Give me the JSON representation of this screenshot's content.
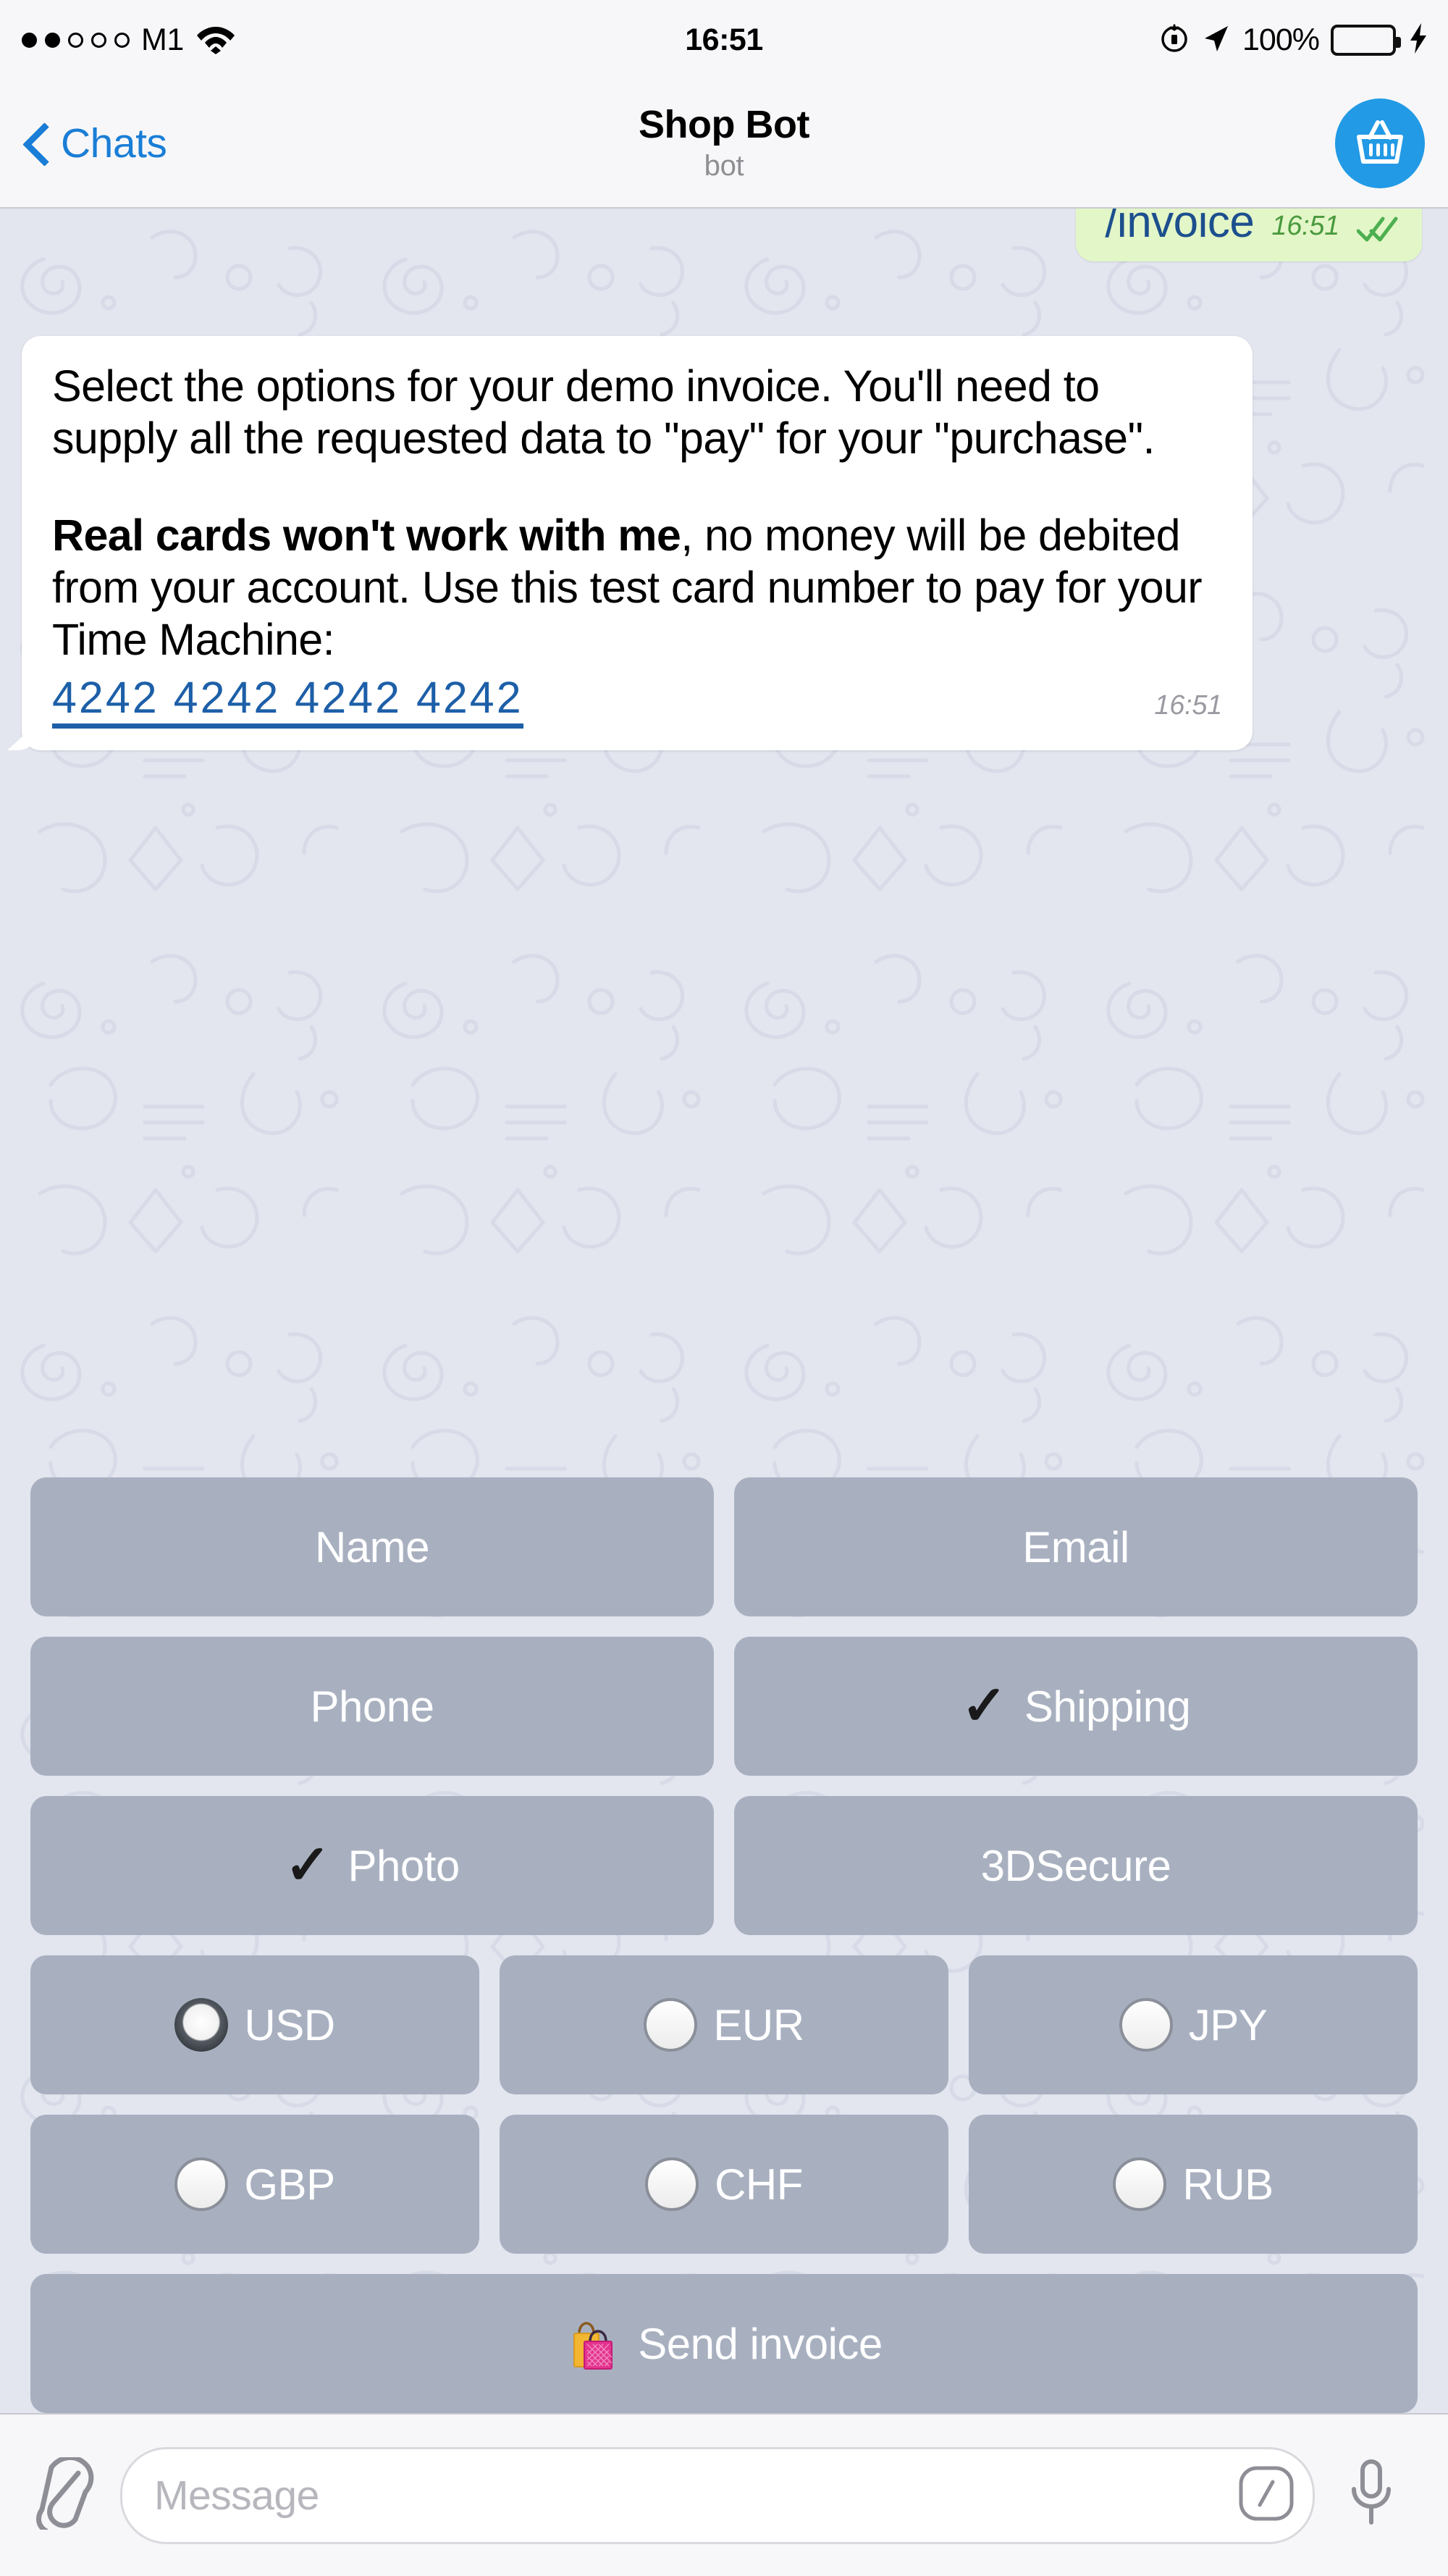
{
  "status_bar": {
    "carrier": "M1",
    "signal_dots_filled": 2,
    "signal_dots_total": 5,
    "wifi_icon": "wifi-icon",
    "time": "16:51",
    "rotation_lock_icon": "rotation-lock-icon",
    "location_icon": "location-arrow-icon",
    "battery_percent": "100%",
    "battery_charging": true,
    "battery_color": "#4cd964"
  },
  "nav_bar": {
    "back_label": "Chats",
    "back_icon": "chevron-left-icon",
    "title": "Shop Bot",
    "subtitle": "bot",
    "avatar_icon": "shopping-basket-icon",
    "avatar_color": "#229ae5",
    "accent_color": "#1a7ed6"
  },
  "chat": {
    "background_color": "#e3e5ef",
    "outgoing_message": {
      "text": "/invoice",
      "time": "16:51",
      "status": "read",
      "bubble_color": "#e3f6c7",
      "text_color": "#1c4f8e"
    },
    "incoming_message": {
      "paragraph_1": "Select the options for your demo invoice. You'll need to supply all the requested data to \"pay\" for your \"purchase\".",
      "paragraph_2_bold": "Real cards won't work with me",
      "paragraph_2_rest": ", no money will be debited from your account. Use this test card number to pay for your Time Machine:",
      "card_number": "4242 4242 4242 4242",
      "card_number_color": "#1d5fa8",
      "time": "16:51",
      "bubble_color": "#ffffff"
    }
  },
  "keyboard": {
    "button_color": "#a8b0c0",
    "label_color": "#ffffff",
    "rows": [
      {
        "columns": 2,
        "buttons": [
          {
            "name": "name",
            "label": "Name",
            "marker": "none"
          },
          {
            "name": "email",
            "label": "Email",
            "marker": "none"
          }
        ]
      },
      {
        "columns": 2,
        "buttons": [
          {
            "name": "phone",
            "label": "Phone",
            "marker": "none"
          },
          {
            "name": "shipping",
            "label": "Shipping",
            "marker": "check",
            "marker_glyph": "✓"
          }
        ]
      },
      {
        "columns": 2,
        "buttons": [
          {
            "name": "photo",
            "label": "Photo",
            "marker": "check",
            "marker_glyph": "✓"
          },
          {
            "name": "3dsecure",
            "label": "3DSecure",
            "marker": "none"
          }
        ]
      },
      {
        "columns": 3,
        "buttons": [
          {
            "name": "usd",
            "label": "USD",
            "marker": "radio-selected"
          },
          {
            "name": "eur",
            "label": "EUR",
            "marker": "radio-empty"
          },
          {
            "name": "jpy",
            "label": "JPY",
            "marker": "radio-empty"
          }
        ]
      },
      {
        "columns": 3,
        "buttons": [
          {
            "name": "gbp",
            "label": "GBP",
            "marker": "radio-empty"
          },
          {
            "name": "chf",
            "label": "CHF",
            "marker": "radio-empty"
          },
          {
            "name": "rub",
            "label": "RUB",
            "marker": "radio-empty"
          }
        ]
      },
      {
        "columns": 1,
        "buttons": [
          {
            "name": "send-invoice",
            "label": "Send invoice",
            "marker": "shopping-bags-emoji"
          }
        ]
      }
    ]
  },
  "input_bar": {
    "attach_icon": "paperclip-icon",
    "placeholder": "Message",
    "value": "",
    "command_icon": "slash-command-icon",
    "mic_icon": "microphone-icon"
  }
}
